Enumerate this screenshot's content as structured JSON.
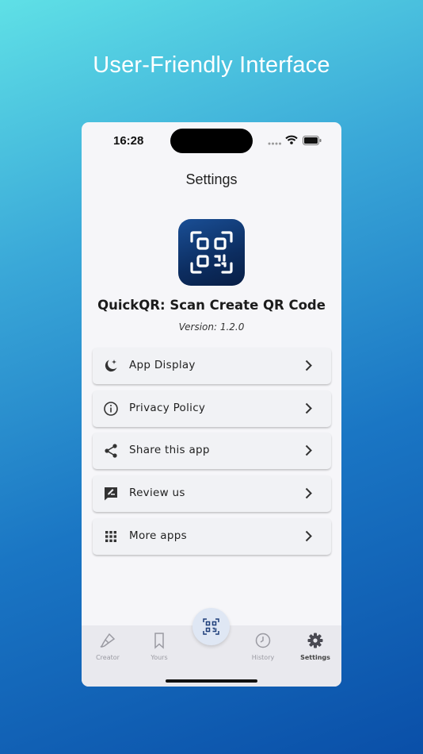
{
  "headline": "User-Friendly Interface",
  "status_bar": {
    "time": "16:28"
  },
  "page_title": "Settings",
  "app": {
    "name": "QuickQR: Scan Create QR Code",
    "version": "Version: 1.2.0"
  },
  "menu": [
    {
      "label": "App Display",
      "icon": "moon-icon"
    },
    {
      "label": "Privacy Policy",
      "icon": "info-icon"
    },
    {
      "label": "Share this app",
      "icon": "share-icon"
    },
    {
      "label": "Review us",
      "icon": "review-icon"
    },
    {
      "label": "More apps",
      "icon": "grid-icon"
    }
  ],
  "tabs": [
    {
      "label": "Creator",
      "icon": "brush-icon"
    },
    {
      "label": "Yours",
      "icon": "bookmark-icon"
    },
    {
      "label": "History",
      "icon": "clock-icon"
    },
    {
      "label": "Settings",
      "icon": "gear-icon",
      "active": true
    }
  ],
  "colors": {
    "accent_dark": "#0c2d60",
    "tab_active": "#444444",
    "tab_inactive": "#9a9aa2"
  }
}
